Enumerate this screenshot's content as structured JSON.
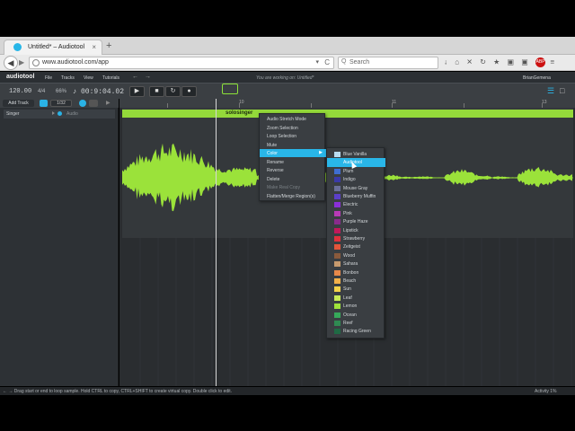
{
  "browser": {
    "tab_title": "Untitled* – Audiotool",
    "tab_close": "×",
    "new_tab": "+",
    "url": "www.audiotool.com/app",
    "search_placeholder": "Search",
    "back_glyph": "◀",
    "forward_glyph": "▶",
    "reload_glyph": "C",
    "dropdown_glyph": "▾",
    "search_glyph": "Q",
    "toolbar_icons": "↓ ⌂ ✕ ↻ ★ ▣ ▣",
    "adblock": "ABP",
    "menu_glyph": "≡"
  },
  "app": {
    "logo": "audiotool",
    "menu": [
      "File",
      "Tracks",
      "View",
      "Tutorials"
    ],
    "undo_glyph": "←",
    "redo_glyph": "→",
    "working_on": "You are working on: Untitled*",
    "user": "BrianGemena"
  },
  "toolbar": {
    "bpm": "120.00",
    "signature": "4/4",
    "percent": "66%",
    "note_glyph": "♪",
    "time": "00:9:04.02",
    "play": "▶",
    "stop": "■",
    "loop": "↻",
    "record": "●"
  },
  "tracks_header": {
    "add_track": "Add Track",
    "grid": "1/32"
  },
  "track": {
    "name": "Singer",
    "type": "Audio"
  },
  "timeline": {
    "labels": [
      "10",
      "11",
      "12",
      "13"
    ]
  },
  "region": {
    "label": "solosinger"
  },
  "context_menu": {
    "items": [
      {
        "label": "Audio Stretch Mode",
        "disabled": false,
        "selected": false
      },
      {
        "label": "Zoom Selection",
        "disabled": false,
        "selected": false
      },
      {
        "label": "Loop Selection",
        "disabled": false,
        "selected": false
      },
      {
        "label": "Mute",
        "disabled": false,
        "selected": false
      },
      {
        "label": "Color",
        "disabled": false,
        "selected": true
      },
      {
        "label": "Rename",
        "disabled": false,
        "selected": false
      },
      {
        "label": "Reverse",
        "disabled": false,
        "selected": false
      },
      {
        "label": "Delete",
        "disabled": false,
        "selected": false
      },
      {
        "label": "Make Real Copy",
        "disabled": true,
        "selected": false
      },
      {
        "label": "Flatten/Merge Region(s)",
        "disabled": false,
        "selected": false
      }
    ],
    "submenu_arrow": "▶"
  },
  "color_menu": {
    "items": [
      {
        "label": "Blue Vanilla",
        "color": "#b9dcf0"
      },
      {
        "label": "Audiotool",
        "color": "#29b6e8",
        "selected": true
      },
      {
        "label": "Plum",
        "color": "#3f6ed1"
      },
      {
        "label": "Indigo",
        "color": "#3b3aa8"
      },
      {
        "label": "Mouse Gray",
        "color": "#6b6f9a"
      },
      {
        "label": "Blueberry Muffin",
        "color": "#5b3fc9"
      },
      {
        "label": "Electric",
        "color": "#8b2fd8"
      },
      {
        "label": "Pink",
        "color": "#b83ab6"
      },
      {
        "label": "Purple Haze",
        "color": "#8a2b8c"
      },
      {
        "label": "Lipstick",
        "color": "#c2185b"
      },
      {
        "label": "Strawberry",
        "color": "#e0303c"
      },
      {
        "label": "Zeitgeist",
        "color": "#e4553a"
      },
      {
        "label": "Wood",
        "color": "#8a5a3c"
      },
      {
        "label": "Sahara",
        "color": "#c79a6e"
      },
      {
        "label": "Bonbon",
        "color": "#e8894a"
      },
      {
        "label": "Beach",
        "color": "#f3b04a"
      },
      {
        "label": "Sun",
        "color": "#f4d24a"
      },
      {
        "label": "Leaf",
        "color": "#c8ea56"
      },
      {
        "label": "Lemon",
        "color": "#9fe23a"
      },
      {
        "label": "Ocean",
        "color": "#36a85a"
      },
      {
        "label": "Reef",
        "color": "#2f8a52"
      },
      {
        "label": "Racing Green",
        "color": "#1f6a44"
      }
    ]
  },
  "status": {
    "message": "← → Drag start or end to loop sample. Hold CTRL to copy, CTRL+SHIFT to create virtual copy. Double click to edit.",
    "activity": "Activity 1%"
  },
  "colors": {
    "accent": "#29b6e8",
    "region": "#94d93a",
    "waveform": "#9be23a"
  }
}
